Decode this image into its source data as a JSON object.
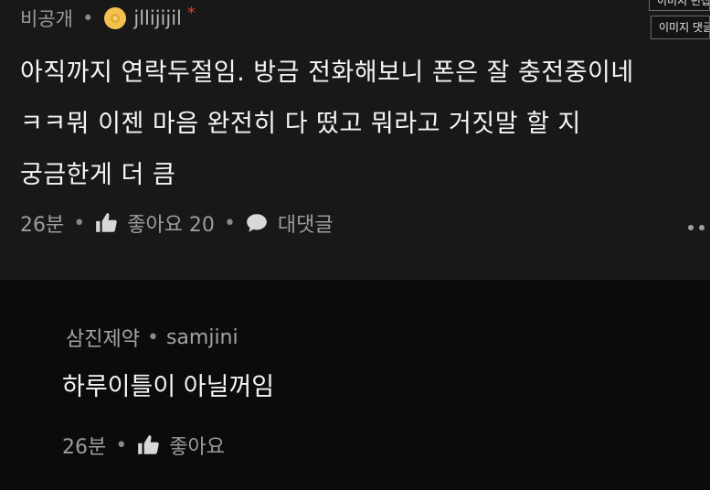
{
  "comment": {
    "privacy": "비공개",
    "nickname": "jllijijil",
    "star": "*",
    "lines": [
      "아직까지 연락두절임. 방금 전화해보니 폰은 잘 충전중이네",
      "ㅋㅋ뭐 이젠 마음 완전히 다 떴고 뭐라고 거짓말 할 지",
      "궁금한게 더 큼"
    ],
    "time": "26분",
    "like_label": "좋아요 20",
    "reply_label": "대댓글"
  },
  "reply": {
    "nickname": "삼진제약",
    "username": "samjini",
    "text": "하루이틀이 아닐꺼임",
    "time": "26분",
    "like_label": "좋아요"
  },
  "tooltips": {
    "top": "이미지 편집",
    "second": "이미지 댓글"
  },
  "separator": "•",
  "icons": [
    "avatar-icon",
    "thumbs-up-icon",
    "chat-bubble-icon",
    "more-dots-icon"
  ],
  "colors": {
    "background": "#0b0b0b",
    "comment_bg": "#181818",
    "star": "#e53935",
    "avatar": "#f2c14e"
  }
}
